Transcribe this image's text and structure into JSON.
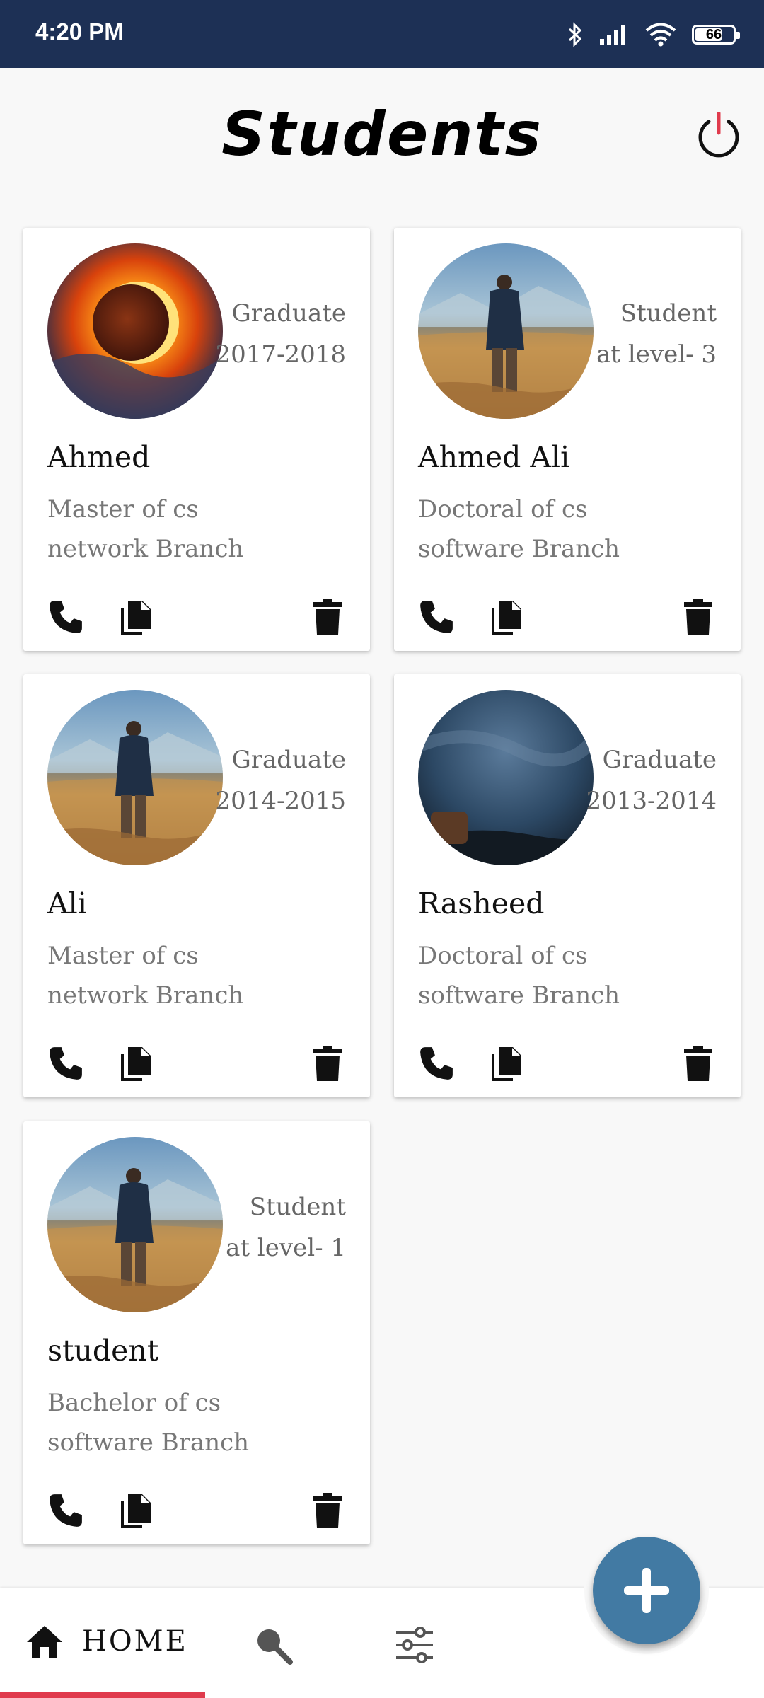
{
  "status_bar": {
    "time": "4:20 PM",
    "battery": "66",
    "icons": [
      "bluetooth-icon",
      "signal-icon",
      "wifi-icon",
      "battery-icon"
    ]
  },
  "header": {
    "title": "Students",
    "power_icon": "power-icon"
  },
  "students": [
    {
      "name": "Ahmed",
      "status_line1": "Graduate",
      "status_line2": "2017-2018",
      "degree_line1": "Master of cs",
      "degree_line2": "network Branch",
      "photo": "eclipse"
    },
    {
      "name": "Ahmed Ali",
      "status_line1": "Student",
      "status_line2": "at level- 3",
      "degree_line1": "Doctoral of cs",
      "degree_line2": "software Branch",
      "photo": "man-in-field"
    },
    {
      "name": "Ali",
      "status_line1": "Graduate",
      "status_line2": "2014-2015",
      "degree_line1": "Master of cs",
      "degree_line2": "network Branch",
      "photo": "man-in-field"
    },
    {
      "name": "Rasheed",
      "status_line1": "Graduate",
      "status_line2": "2013-2014",
      "degree_line1": "Doctoral of cs",
      "degree_line2": "software Branch",
      "photo": "stormy-sky"
    },
    {
      "name": "student",
      "status_line1": "Student",
      "status_line2": "at level- 1",
      "degree_line1": "Bachelor of cs",
      "degree_line2": "software Branch",
      "photo": "man-in-field"
    }
  ],
  "card_actions": [
    "phone-icon",
    "copy-icon",
    "delete-icon"
  ],
  "fab": {
    "icon": "plus-icon"
  },
  "bottom_nav": {
    "home_label": "HOME",
    "items": [
      "home-icon",
      "search-icon",
      "filter-icon"
    ]
  },
  "colors": {
    "status_bar": "#1d3055",
    "fab": "#427aa3",
    "active_indicator": "#e03b4d"
  }
}
